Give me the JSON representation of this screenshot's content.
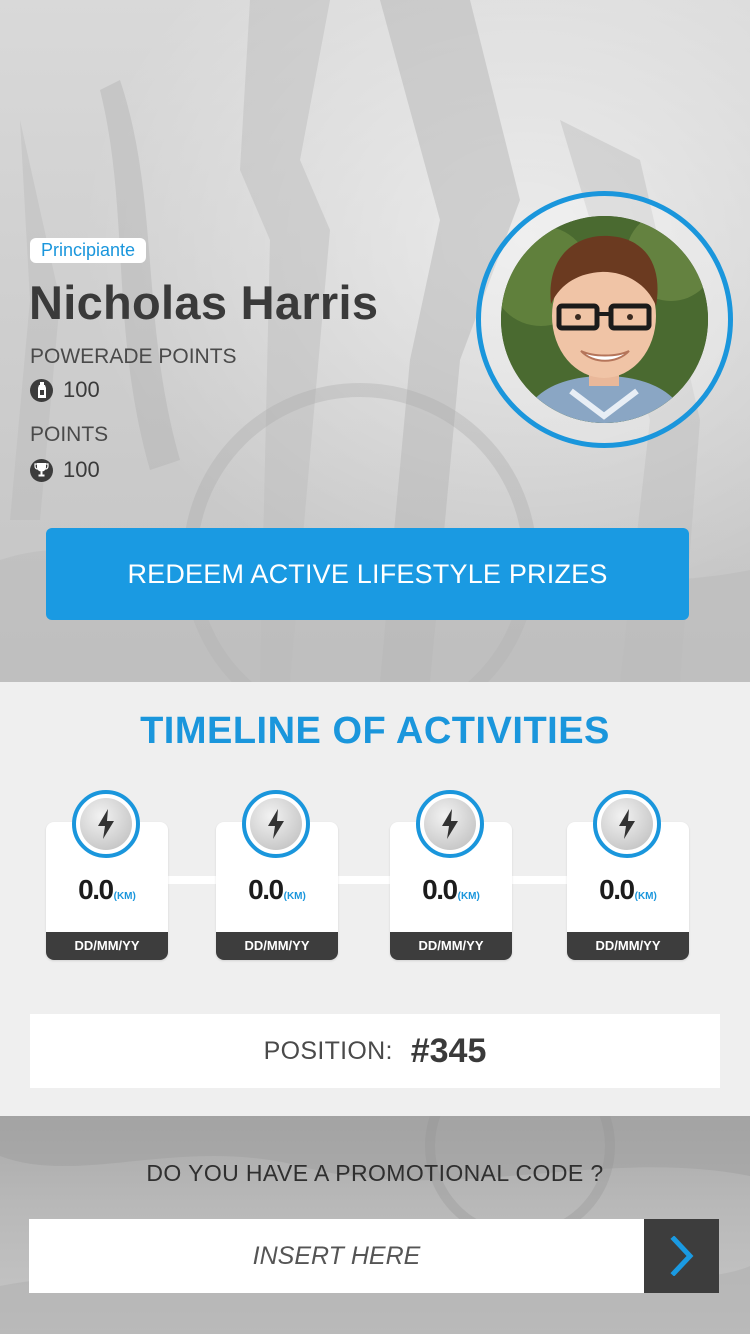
{
  "profile": {
    "level": "Principiante",
    "name": "Nicholas Harris",
    "powerade_points_label": "POWERADE POINTS",
    "powerade_points_value": "100",
    "powerade_icon": "bottle-icon",
    "points_label": "POINTS",
    "points_value": "100",
    "points_icon": "trophy-icon"
  },
  "redeem_button": {
    "label": "REDEEM ACTIVE LIFESTYLE PRIZES"
  },
  "timeline": {
    "title": "TIMELINE OF ACTIVITIES",
    "activities": [
      {
        "value": "0.0",
        "unit": "(KM)",
        "date": "DD/MM/YY",
        "icon": "lightning-icon"
      },
      {
        "value": "0.0",
        "unit": "(KM)",
        "date": "DD/MM/YY",
        "icon": "lightning-icon"
      },
      {
        "value": "0.0",
        "unit": "(KM)",
        "date": "DD/MM/YY",
        "icon": "lightning-icon"
      },
      {
        "value": "0.0",
        "unit": "(KM)",
        "date": "DD/MM/YY",
        "icon": "lightning-icon"
      }
    ]
  },
  "position": {
    "label": "POSITION:",
    "value": "#345"
  },
  "promo": {
    "question": "DO YOU HAVE A PROMOTIONAL CODE ?",
    "placeholder": "INSERT HERE",
    "submit_icon": "chevron-right-icon"
  },
  "colors": {
    "accent": "#1a96dc",
    "button": "#1a9ae2",
    "dark": "#3d3d3d"
  }
}
